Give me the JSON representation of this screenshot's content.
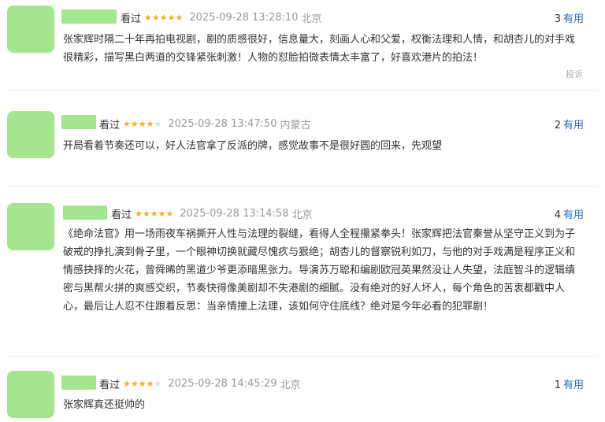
{
  "colors": {
    "accent": "#2468c9",
    "star_on": "#f6ad1c",
    "star_off": "#d9d9d9",
    "avatar": "#a5e58f"
  },
  "reviews": [
    {
      "watched": "看过",
      "stars": 5,
      "time": "2025-09-28 13:28:10",
      "location": "北京",
      "useful_count": "3",
      "useful_label": "有用",
      "content": "张家辉时隔二十年再拍电视剧，剧的质感很好，信息量大，刻画人心和父爱，权衡法理和人情，和胡杏儿的对手戏很精彩，描写黑白两道的交锋紧张刺激！人物的怼脸拍微表情太丰富了，好喜欢港片的拍法！",
      "complain": "投诉"
    },
    {
      "watched": "看过",
      "stars": 4,
      "time": "2025-09-28 13:47:50",
      "location": "内蒙古",
      "useful_count": "2",
      "useful_label": "有用",
      "content": "开局看着节奏还可以，好人法官拿了反派的牌，感觉故事不是很好圆的回来，先观望"
    },
    {
      "watched": "看过",
      "stars": 5,
      "time": "2025-09-28 13:14:58",
      "location": "北京",
      "useful_count": "4",
      "useful_label": "有用",
      "content": "《绝命法官》用一场雨夜车祸撕开人性与法理的裂缝，看得人全程攥紧拳头！张家辉把法官秦誉从坚守正义到为子破戒的挣扎演到骨子里，一个眼神切换就藏尽愧疚与狠绝；胡杏儿的督察锐利如刀，与他的对手戏满是程序正义和情感抉择的火花，曾舜晞的黑道少爷更添暗黑张力。导演苏万聪和编剧欧冠英果然没让人失望，法庭智斗的逻辑缜密与黑帮火拼的爽感交织，节奏快得像美剧却不失港剧的细腻。没有绝对的好人坏人，每个角色的苦衷都戳中人心，最后让人忍不住跟着反思：当亲情撞上法理，该如何守住底线？绝对是今年必看的犯罪剧！"
    },
    {
      "watched": "看过",
      "stars": 4,
      "time": "2025-09-28 14:45:29",
      "location": "北京",
      "useful_count": "1",
      "useful_label": "有用",
      "content": "张家辉真还挺帅的"
    }
  ]
}
